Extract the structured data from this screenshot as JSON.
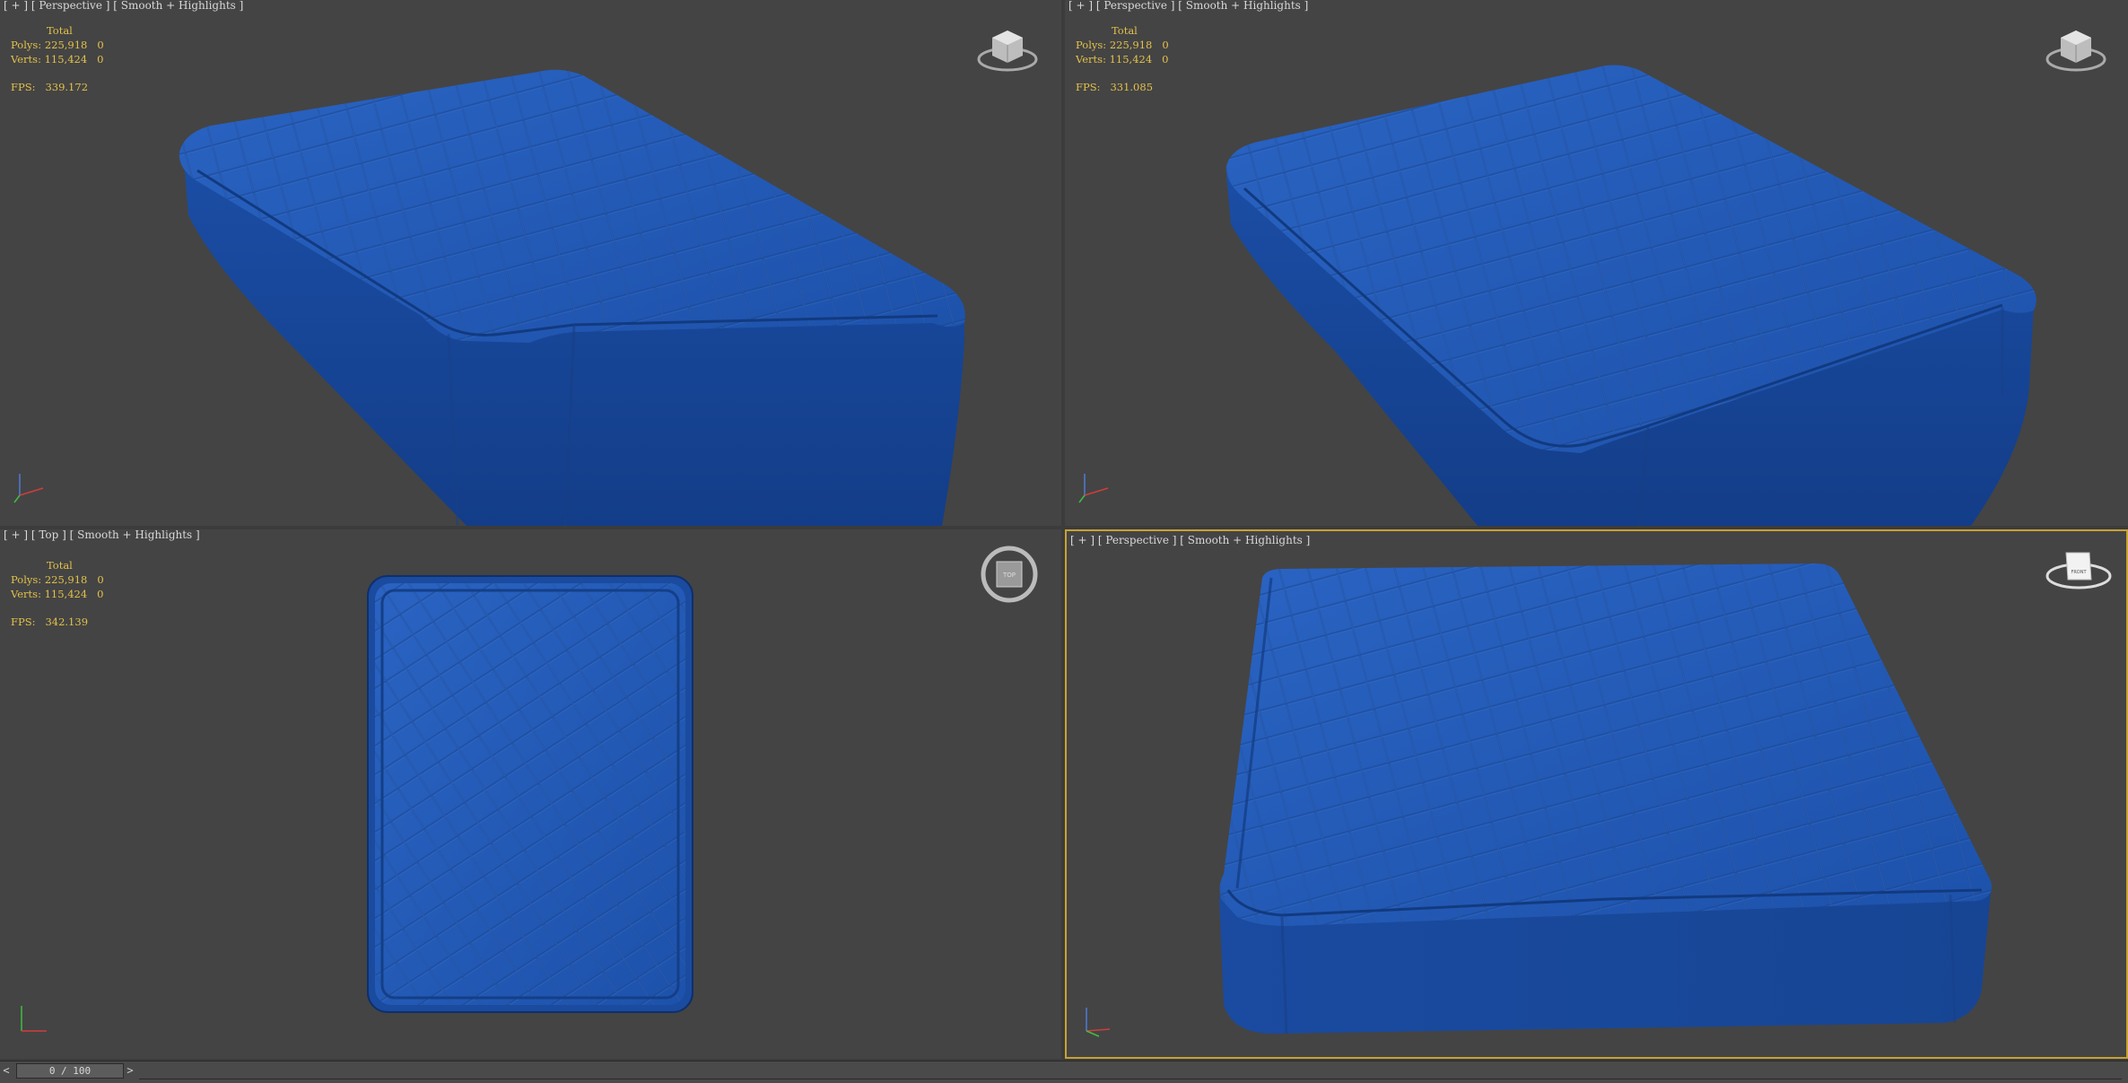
{
  "viewports": [
    {
      "id": "tl",
      "label": "[ + ] [ Perspective ] [ Smooth + Highlights ]",
      "stats": {
        "total": "Total",
        "polys_label": "Polys:",
        "polys": "225,918",
        "polys_sel": "0",
        "verts_label": "Verts:",
        "verts": "115,424",
        "verts_sel": "0",
        "fps_label": "FPS:",
        "fps": "339.172"
      }
    },
    {
      "id": "tr",
      "label": "[ + ] [ Perspective ] [ Smooth + Highlights ]",
      "stats": {
        "total": "Total",
        "polys_label": "Polys:",
        "polys": "225,918",
        "polys_sel": "0",
        "verts_label": "Verts:",
        "verts": "115,424",
        "verts_sel": "0",
        "fps_label": "FPS:",
        "fps": "331.085"
      }
    },
    {
      "id": "bl",
      "label": "[ + ] [ Top ] [ Smooth + Highlights ]",
      "stats": {
        "total": "Total",
        "polys_label": "Polys:",
        "polys": "225,918",
        "polys_sel": "0",
        "verts_label": "Verts:",
        "verts": "115,424",
        "verts_sel": "0",
        "fps_label": "FPS:",
        "fps": "342.139"
      }
    },
    {
      "id": "br",
      "label": "[ + ] [ Perspective ] [ Smooth + Highlights ]",
      "stats": null
    }
  ],
  "viewcube": {
    "top_label": "TOP",
    "front_label": "FRONT"
  },
  "timeline": {
    "prev": "<",
    "next": ">",
    "frame": "0 / 100"
  },
  "colors": {
    "viewport_bg": "#444444",
    "active_border": "#c8a232",
    "stats_text": "#e3c14a",
    "mattress": "#1f56b0"
  },
  "icons": {
    "viewcube": "viewcube-icon",
    "axis": "axis-tripod-icon"
  }
}
